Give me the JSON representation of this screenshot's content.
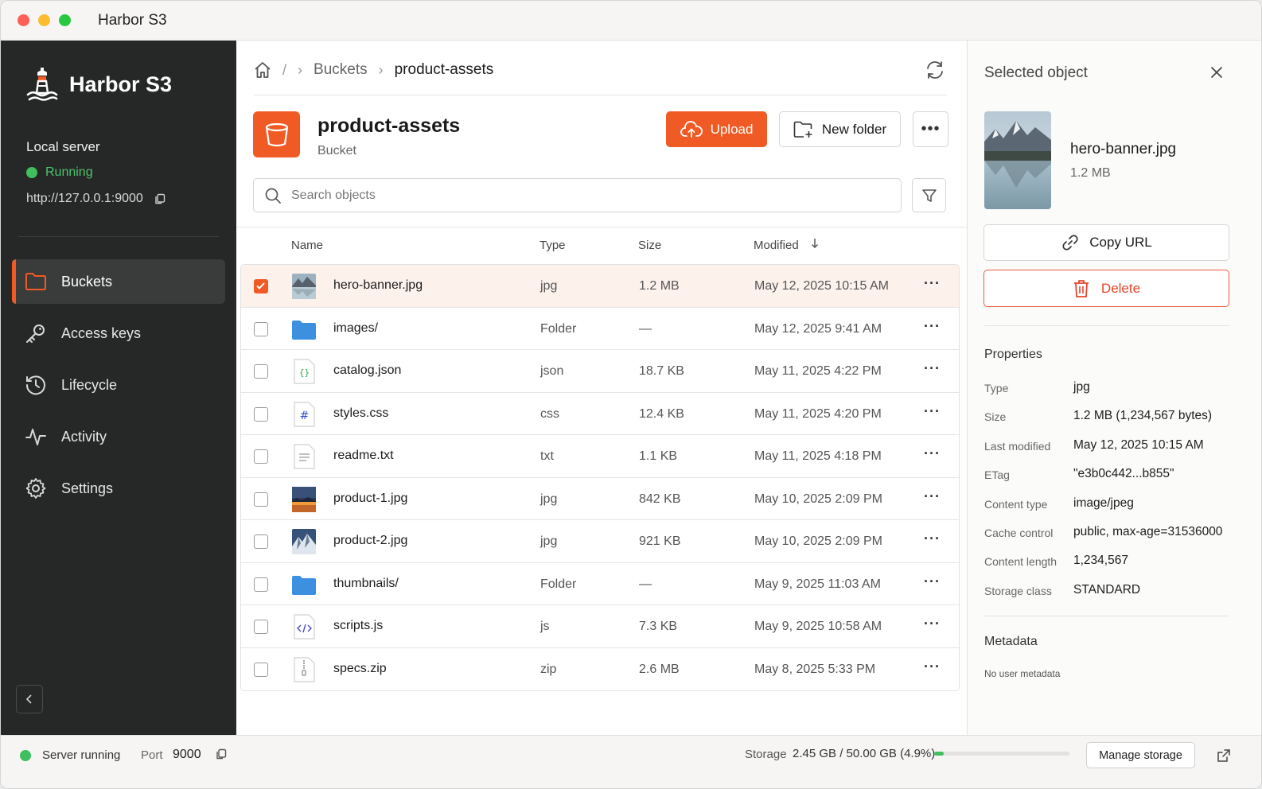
{
  "window": {
    "title": "Harbor S3"
  },
  "sidebar": {
    "brand": "Harbor S3",
    "server_label": "Local server",
    "server_status": "Running",
    "server_url": "http://127.0.0.1:9000",
    "nav": [
      {
        "label": "Buckets",
        "icon": "folder-icon",
        "active": true
      },
      {
        "label": "Access keys",
        "icon": "key-icon",
        "active": false
      },
      {
        "label": "Lifecycle",
        "icon": "history-icon",
        "active": false
      },
      {
        "label": "Activity",
        "icon": "activity-icon",
        "active": false
      },
      {
        "label": "Settings",
        "icon": "gear-icon",
        "active": false
      }
    ]
  },
  "breadcrumb": {
    "root": "/",
    "parent": "Buckets",
    "current": "product-assets"
  },
  "bucket": {
    "name": "product-assets",
    "subtitle": "Bucket"
  },
  "toolbar": {
    "upload_label": "Upload",
    "new_folder_label": "New folder"
  },
  "search": {
    "placeholder": "Search objects",
    "value": ""
  },
  "table": {
    "columns": {
      "name": "Name",
      "type": "Type",
      "size": "Size",
      "modified": "Modified",
      "sort": "descending"
    },
    "rows": [
      {
        "name": "hero-banner.jpg",
        "type": "jpg",
        "size": "1.2 MB",
        "modified": "May 12, 2025 10:15 AM",
        "icon": "image-thumb-lake",
        "selected": true
      },
      {
        "name": "images/",
        "type": "Folder",
        "size": "—",
        "modified": "May 12, 2025 9:41 AM",
        "icon": "folder-icon",
        "selected": false
      },
      {
        "name": "catalog.json",
        "type": "json",
        "size": "18.7 KB",
        "modified": "May 11, 2025 4:22 PM",
        "icon": "json-file-icon",
        "selected": false
      },
      {
        "name": "styles.css",
        "type": "css",
        "size": "12.4 KB",
        "modified": "May 11, 2025 4:20 PM",
        "icon": "css-file-icon",
        "selected": false
      },
      {
        "name": "readme.txt",
        "type": "txt",
        "size": "1.1 KB",
        "modified": "May 11, 2025 4:18 PM",
        "icon": "text-file-icon",
        "selected": false
      },
      {
        "name": "product-1.jpg",
        "type": "jpg",
        "size": "842 KB",
        "modified": "May 10, 2025 2:09 PM",
        "icon": "image-thumb-sunset",
        "selected": false
      },
      {
        "name": "product-2.jpg",
        "type": "jpg",
        "size": "921 KB",
        "modified": "May 10, 2025 2:09 PM",
        "icon": "image-thumb-mountain",
        "selected": false
      },
      {
        "name": "thumbnails/",
        "type": "Folder",
        "size": "—",
        "modified": "May 9, 2025 11:03 AM",
        "icon": "folder-icon",
        "selected": false
      },
      {
        "name": "scripts.js",
        "type": "js",
        "size": "7.3 KB",
        "modified": "May 9, 2025 10:58 AM",
        "icon": "code-file-icon",
        "selected": false
      },
      {
        "name": "specs.zip",
        "type": "zip",
        "size": "2.6 MB",
        "modified": "May 8, 2025 5:33 PM",
        "icon": "zip-file-icon",
        "selected": false
      }
    ]
  },
  "panel": {
    "title": "Selected object",
    "file_name": "hero-banner.jpg",
    "file_size": "1.2 MB",
    "copy_label": "Copy URL",
    "delete_label": "Delete",
    "properties_title": "Properties",
    "properties": [
      {
        "key": "Type",
        "value": "jpg"
      },
      {
        "key": "Size",
        "value": "1.2 MB (1,234,567 bytes)"
      },
      {
        "key": "Last modified",
        "value": "May 12, 2025 10:15 AM"
      },
      {
        "key": "ETag",
        "value": "\"e3b0c442...b855\""
      },
      {
        "key": "Content type",
        "value": "image/jpeg"
      },
      {
        "key": "Cache control",
        "value": "public, max-age=31536000"
      },
      {
        "key": "Content length",
        "value": "1,234,567"
      },
      {
        "key": "Storage class",
        "value": "STANDARD"
      }
    ],
    "metadata_title": "Metadata",
    "metadata_empty": "No user metadata"
  },
  "statusbar": {
    "server_text": "Server running",
    "port_label": "Port",
    "port_value": "9000",
    "storage_label": "Storage",
    "storage_value": "2.45 GB / 50.00 GB (4.9%)",
    "storage_fraction": 0.049,
    "manage_label": "Manage storage"
  },
  "colors": {
    "accent": "#f05a24",
    "running": "#3fbf5e",
    "danger": "#e5452b",
    "sidebar_bg": "#262828"
  }
}
